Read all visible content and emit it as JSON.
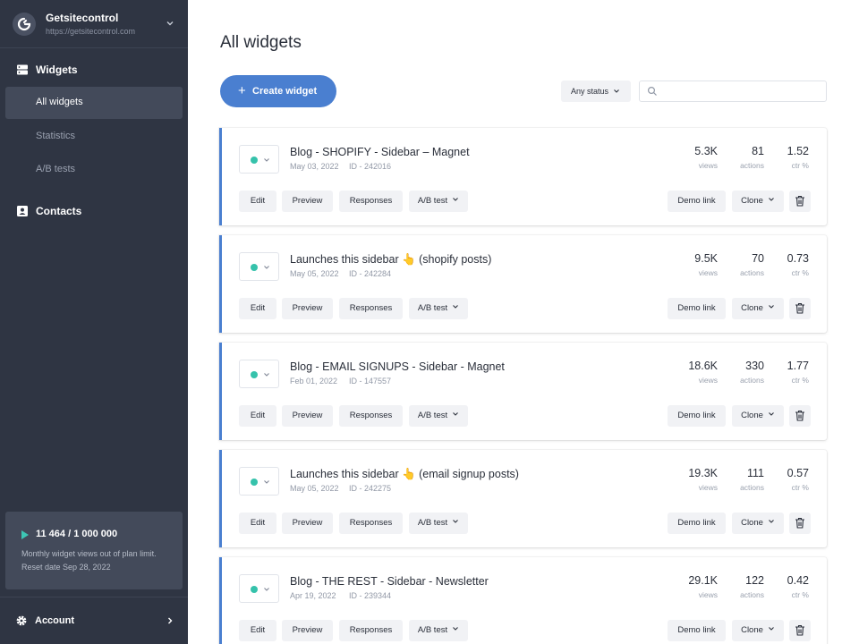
{
  "brand": {
    "name": "Getsitecontrol",
    "url": "https://getsitecontrol.com"
  },
  "nav": {
    "widgets": "Widgets",
    "items": [
      "All widgets",
      "Statistics",
      "A/B tests"
    ],
    "contacts": "Contacts"
  },
  "usage": {
    "count": "11 464 / 1 000 000",
    "note": "Monthly widget views out of plan limit.",
    "reset": "Reset date Sep 28, 2022"
  },
  "account": {
    "label": "Account"
  },
  "main": {
    "title": "All widgets",
    "create_label": "Create widget",
    "status_filter": "Any status",
    "search_placeholder": ""
  },
  "card_labels": {
    "edit": "Edit",
    "preview": "Preview",
    "responses": "Responses",
    "abtest": "A/B test",
    "demo": "Demo link",
    "clone": "Clone",
    "views": "views",
    "actions": "actions",
    "ctr": "ctr %"
  },
  "widgets": [
    {
      "title": "Blog - SHOPIFY - Sidebar – Magnet",
      "date": "May 03, 2022",
      "id": "ID - 242016",
      "views": "5.3K",
      "actions": "81",
      "ctr": "1.52"
    },
    {
      "title": "Launches this sidebar 👆 (shopify posts)",
      "date": "May 05, 2022",
      "id": "ID - 242284",
      "views": "9.5K",
      "actions": "70",
      "ctr": "0.73"
    },
    {
      "title": "Blog - EMAIL SIGNUPS - Sidebar - Magnet",
      "date": "Feb 01, 2022",
      "id": "ID - 147557",
      "views": "18.6K",
      "actions": "330",
      "ctr": "1.77"
    },
    {
      "title": "Launches this sidebar 👆 (email signup posts)",
      "date": "May 05, 2022",
      "id": "ID - 242275",
      "views": "19.3K",
      "actions": "111",
      "ctr": "0.57"
    },
    {
      "title": "Blog - THE REST - Sidebar - Newsletter",
      "date": "Apr 19, 2022",
      "id": "ID - 239344",
      "views": "29.1K",
      "actions": "122",
      "ctr": "0.42"
    }
  ]
}
